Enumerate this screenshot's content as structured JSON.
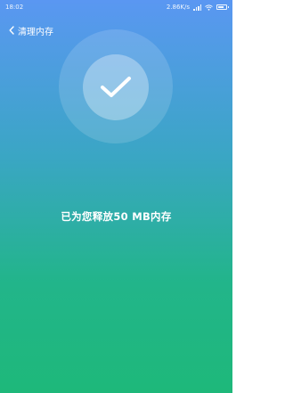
{
  "status_bar": {
    "time": "18:02",
    "network_speed": "2.86K/s"
  },
  "nav": {
    "back_icon": "chevron-left-icon",
    "title": "清理内存"
  },
  "status_icon": "checkmark-icon",
  "result": {
    "message": "已为您释放50 MB内存"
  }
}
